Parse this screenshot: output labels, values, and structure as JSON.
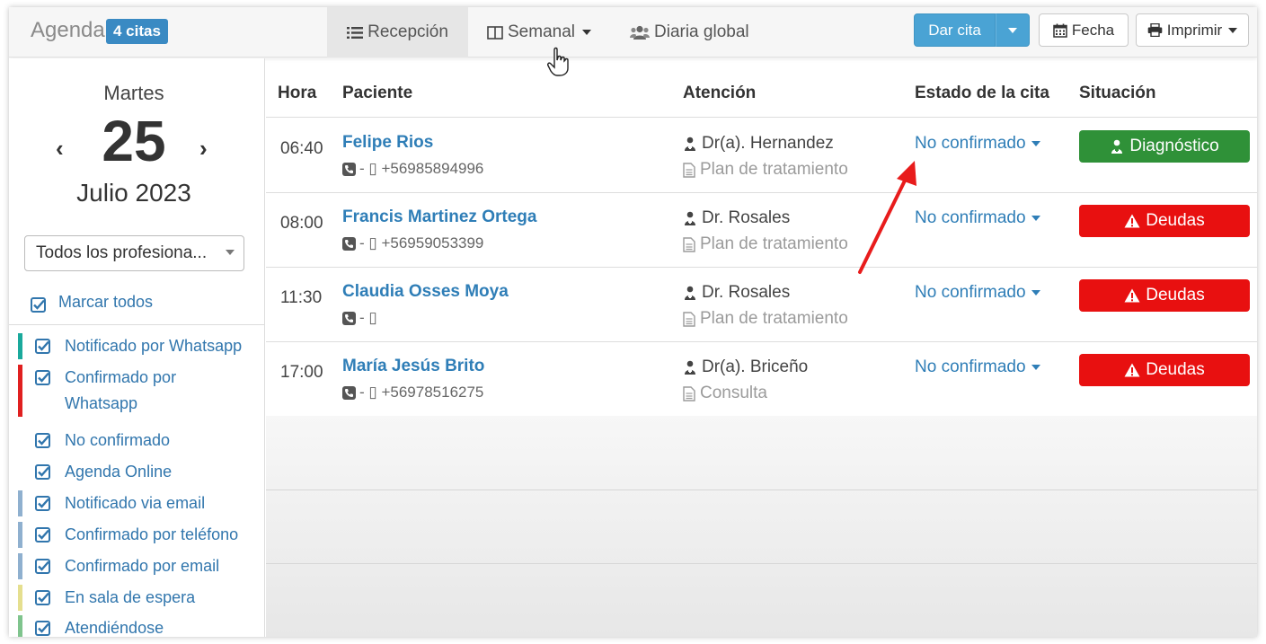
{
  "header": {
    "brand": "Agenda",
    "count_badge": "4 citas",
    "tabs": [
      {
        "label": "Recepción",
        "icon": "list-icon"
      },
      {
        "label": "Semanal",
        "icon": "columns-icon"
      },
      {
        "label": "Diaria global",
        "icon": "users-icon"
      }
    ],
    "dar_cita": "Dar cita",
    "fecha": "Fecha",
    "imprimir": "Imprimir"
  },
  "date": {
    "day_name": "Martes",
    "day_number": "25",
    "month_year": "Julio 2023",
    "prev": "‹",
    "next": "›"
  },
  "professional_select": {
    "value": "Todos los profesiona..."
  },
  "filters": {
    "mark_all": "Marcar todos",
    "items": [
      {
        "label": "Notificado por Whatsapp",
        "color": "#1aa99c"
      },
      {
        "label": "Confirmado por Whatsapp",
        "color": "#e02020"
      },
      {
        "label": "No confirmado",
        "color": ""
      },
      {
        "label": "Agenda Online",
        "color": ""
      },
      {
        "label": "Notificado via email",
        "color": "#8fb0cf"
      },
      {
        "label": "Confirmado por teléfono",
        "color": "#8fb0cf"
      },
      {
        "label": "Confirmado por email",
        "color": "#8fb0cf"
      },
      {
        "label": "En sala de espera",
        "color": "#e5df8f"
      },
      {
        "label": "Atendiéndose",
        "color": "#7fc48d"
      }
    ]
  },
  "table": {
    "headers": [
      "Hora",
      "Paciente",
      "Atención",
      "Estado de la cita",
      "Situación"
    ],
    "rows": [
      {
        "hora": "06:40",
        "paciente": "Felipe Rios",
        "telefono": "- ▯ +56985894996",
        "profesional": "Dr(a). Hernandez",
        "tipo": "Plan de tratamiento",
        "estado": "No confirmado",
        "situacion": "Diagnóstico",
        "situacion_color": "#2f9138"
      },
      {
        "hora": "08:00",
        "paciente": "Francis Martinez Ortega",
        "telefono": "- ▯ +56959053399",
        "profesional": "Dr. Rosales",
        "tipo": "Plan de tratamiento",
        "estado": "No confirmado",
        "situacion": "Deudas",
        "situacion_color": "#e81010"
      },
      {
        "hora": "11:30",
        "paciente": "Claudia Osses Moya",
        "telefono": "- ▯",
        "profesional": "Dr. Rosales",
        "tipo": "Plan de tratamiento",
        "estado": "No confirmado",
        "situacion": "Deudas",
        "situacion_color": "#e81010"
      },
      {
        "hora": "17:00",
        "paciente": "María Jesús Brito",
        "telefono": "- ▯ +56978516275",
        "profesional": "Dr(a). Briceño",
        "tipo": "Consulta",
        "estado": "No confirmado",
        "situacion": "Deudas",
        "situacion_color": "#e81010"
      }
    ]
  }
}
